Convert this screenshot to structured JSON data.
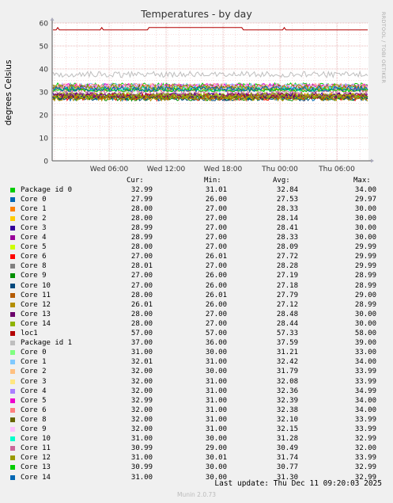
{
  "title": "Temperatures - by day",
  "side_tag": "RRDTOOL / TOBI OETIKER",
  "footer": {
    "last_update": "Last update: Thu Dec 11 09:20:03 2025",
    "version": "Munin 2.0.73"
  },
  "legend_headers": {
    "cur": "Cur:",
    "min": "Min:",
    "avg": "Avg:",
    "max": "Max:"
  },
  "chart_data": {
    "type": "line",
    "title": "Temperatures - by day",
    "ylabel": "degrees Celsius",
    "ylim": [
      0,
      60
    ],
    "yticks": [
      "0",
      "10",
      "20",
      "30",
      "40",
      "50",
      "60"
    ],
    "xticks": [
      "Wed 06:00",
      "Wed 12:00",
      "Wed 18:00",
      "Thu 00:00",
      "Thu 06:00"
    ],
    "grid": true,
    "series": [
      {
        "name": "Package id 0",
        "color": "#00cc00",
        "cur": "32.99",
        "min": "31.01",
        "avg": "32.84",
        "max": "34.00"
      },
      {
        "name": "Core 0",
        "color": "#0066b3",
        "cur": "27.99",
        "min": "26.00",
        "avg": "27.53",
        "max": "29.97"
      },
      {
        "name": "Core 1",
        "color": "#ff8000",
        "cur": "28.00",
        "min": "27.00",
        "avg": "28.33",
        "max": "30.00"
      },
      {
        "name": "Core 2",
        "color": "#ffcc00",
        "cur": "28.00",
        "min": "27.00",
        "avg": "28.14",
        "max": "30.00"
      },
      {
        "name": "Core 3",
        "color": "#330099",
        "cur": "28.99",
        "min": "27.00",
        "avg": "28.41",
        "max": "30.00"
      },
      {
        "name": "Core 4",
        "color": "#990099",
        "cur": "28.99",
        "min": "27.00",
        "avg": "28.33",
        "max": "30.00"
      },
      {
        "name": "Core 5",
        "color": "#ccff00",
        "cur": "28.00",
        "min": "27.00",
        "avg": "28.09",
        "max": "29.99"
      },
      {
        "name": "Core 6",
        "color": "#ff0000",
        "cur": "27.00",
        "min": "26.01",
        "avg": "27.72",
        "max": "29.99"
      },
      {
        "name": "Core 8",
        "color": "#808080",
        "cur": "28.01",
        "min": "27.00",
        "avg": "28.28",
        "max": "29.99"
      },
      {
        "name": "Core 9",
        "color": "#008f00",
        "cur": "27.00",
        "min": "26.00",
        "avg": "27.19",
        "max": "28.99"
      },
      {
        "name": "Core 10",
        "color": "#00487d",
        "cur": "27.00",
        "min": "26.00",
        "avg": "27.18",
        "max": "28.99"
      },
      {
        "name": "Core 11",
        "color": "#b35a00",
        "cur": "28.00",
        "min": "26.01",
        "avg": "27.79",
        "max": "29.00"
      },
      {
        "name": "Core 12",
        "color": "#b38f00",
        "cur": "26.01",
        "min": "26.00",
        "avg": "27.12",
        "max": "28.99"
      },
      {
        "name": "Core 13",
        "color": "#6b006b",
        "cur": "28.00",
        "min": "27.00",
        "avg": "28.48",
        "max": "30.00"
      },
      {
        "name": "Core 14",
        "color": "#8fb300",
        "cur": "28.00",
        "min": "27.00",
        "avg": "28.44",
        "max": "30.00"
      },
      {
        "name": "loc1",
        "color": "#b30000",
        "cur": "57.00",
        "min": "57.00",
        "avg": "57.33",
        "max": "58.00"
      },
      {
        "name": "Package id 1",
        "color": "#bebebe",
        "cur": "37.00",
        "min": "36.00",
        "avg": "37.59",
        "max": "39.00"
      },
      {
        "name": "Core 0",
        "color": "#80ff80",
        "cur": "31.00",
        "min": "30.00",
        "avg": "31.21",
        "max": "33.00"
      },
      {
        "name": "Core 1",
        "color": "#80c9ff",
        "cur": "32.01",
        "min": "31.00",
        "avg": "32.42",
        "max": "34.00"
      },
      {
        "name": "Core 2",
        "color": "#ffc080",
        "cur": "32.00",
        "min": "30.00",
        "avg": "31.79",
        "max": "33.99"
      },
      {
        "name": "Core 3",
        "color": "#ffe680",
        "cur": "32.00",
        "min": "31.00",
        "avg": "32.08",
        "max": "33.99"
      },
      {
        "name": "Core 4",
        "color": "#aa80ff",
        "cur": "32.00",
        "min": "31.00",
        "avg": "32.36",
        "max": "34.99"
      },
      {
        "name": "Core 5",
        "color": "#ee00cc",
        "cur": "32.99",
        "min": "31.00",
        "avg": "32.39",
        "max": "34.00"
      },
      {
        "name": "Core 6",
        "color": "#ff8080",
        "cur": "32.00",
        "min": "31.00",
        "avg": "32.38",
        "max": "34.00"
      },
      {
        "name": "Core 8",
        "color": "#666600",
        "cur": "32.00",
        "min": "31.00",
        "avg": "32.10",
        "max": "33.99"
      },
      {
        "name": "Core 9",
        "color": "#ffbfff",
        "cur": "32.00",
        "min": "31.00",
        "avg": "32.15",
        "max": "33.99"
      },
      {
        "name": "Core 10",
        "color": "#00ffcc",
        "cur": "31.00",
        "min": "30.00",
        "avg": "31.28",
        "max": "32.99"
      },
      {
        "name": "Core 11",
        "color": "#cc6699",
        "cur": "30.99",
        "min": "29.00",
        "avg": "30.49",
        "max": "32.00"
      },
      {
        "name": "Core 12",
        "color": "#999900",
        "cur": "31.00",
        "min": "30.01",
        "avg": "31.74",
        "max": "33.99"
      },
      {
        "name": "Core 13",
        "color": "#00cc00",
        "cur": "30.99",
        "min": "30.00",
        "avg": "30.77",
        "max": "32.99"
      },
      {
        "name": "Core 14",
        "color": "#0066b3",
        "cur": "31.00",
        "min": "30.00",
        "avg": "31.30",
        "max": "32.99"
      }
    ]
  }
}
